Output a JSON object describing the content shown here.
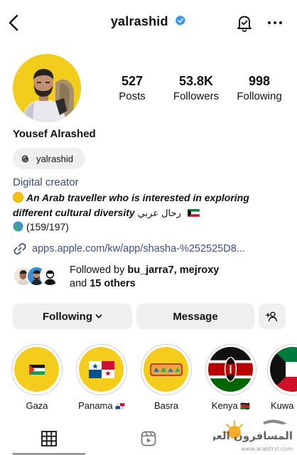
{
  "header": {
    "username": "yalrashid",
    "icons": {
      "back": "chevron-left-icon",
      "verified": "verified-badge-icon",
      "notifications": "bell-check-icon",
      "more": "more-horizontal-icon"
    }
  },
  "stats": {
    "posts": {
      "value": "527",
      "label": "Posts"
    },
    "followers": {
      "value": "53.8K",
      "label": "Followers"
    },
    "following": {
      "value": "998",
      "label": "Following"
    }
  },
  "profile": {
    "full_name": "Yousef Alrashed",
    "threads_handle": "yalrashid",
    "category": "Digital creator",
    "bio_line1": "An Arab traveller who is interested in exploring",
    "bio_line2": "different cultural diversity",
    "bio_arabic": "رحال عربي",
    "bio_line3": "(159/197)",
    "link": "apps.apple.com/kw/app/shasha-%252525D8..."
  },
  "followed_by": {
    "prefix": "Followed by",
    "users": "bu_jarra7, mejroxy",
    "and": "and",
    "others": "15 others"
  },
  "buttons": {
    "following": "Following",
    "message": "Message",
    "add_user_icon": "add-person-icon"
  },
  "highlights": [
    {
      "label": "Gaza",
      "flag": ""
    },
    {
      "label": "Panama",
      "flag": "🇵🇦"
    },
    {
      "label": "Basra",
      "flag": ""
    },
    {
      "label": "Kenya",
      "flag": "🇰🇪"
    },
    {
      "label": "Kuwa",
      "flag": ""
    }
  ],
  "tabs": {
    "grid": "grid-icon",
    "reels": "reels-icon"
  },
  "watermark": {
    "text": "المسافرون العرب",
    "url": "www.arabtrvl.com"
  },
  "colors": {
    "accent_blue": "#3897f0",
    "link_color": "#3d4f7d",
    "avatar_bg": "#f3cd1c",
    "button_bg": "#efefef"
  }
}
